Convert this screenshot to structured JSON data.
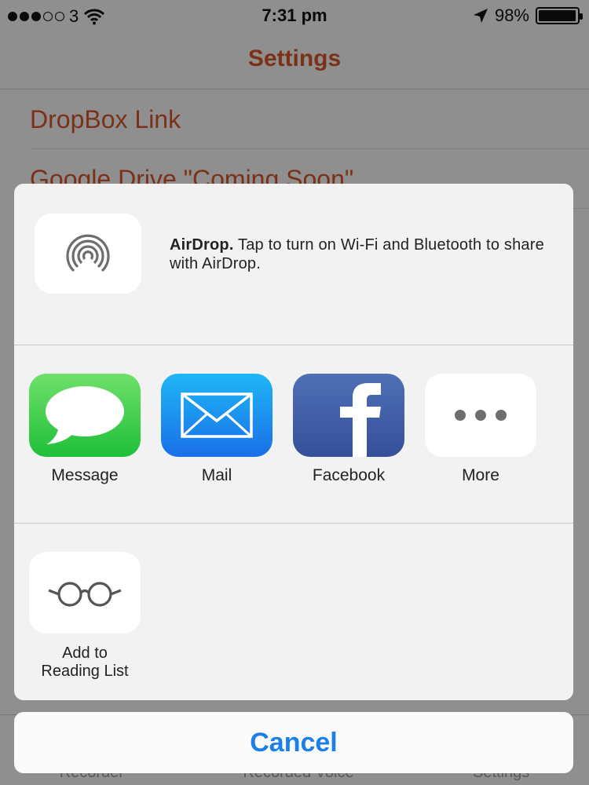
{
  "status_bar": {
    "carrier": "3",
    "time": "7:31 pm",
    "battery": "98%",
    "battery_level": 0.98
  },
  "nav": {
    "title": "Settings"
  },
  "settings": {
    "rows": [
      {
        "label": "DropBox Link"
      },
      {
        "label": "Google Drive \"Coming Soon\""
      }
    ]
  },
  "tabbar": {
    "items": [
      {
        "label": "Recorder"
      },
      {
        "label": "Recorded Voice"
      },
      {
        "label": "Settings"
      }
    ]
  },
  "share": {
    "airdrop": {
      "title": "AirDrop.",
      "message": " Tap to turn on Wi-Fi and Bluetooth to share with AirDrop."
    },
    "apps": [
      {
        "label": "Message",
        "icon": "message-icon"
      },
      {
        "label": "Mail",
        "icon": "mail-icon"
      },
      {
        "label": "Facebook",
        "icon": "facebook-icon"
      },
      {
        "label": "More",
        "icon": "more-icon"
      }
    ],
    "actions": [
      {
        "line1": "Add to",
        "line2": "Reading List",
        "icon": "reading-glasses-icon"
      }
    ],
    "cancel_label": "Cancel"
  },
  "colors": {
    "accent_orange": "#d4552a",
    "ios_blue": "#1a80e8",
    "message_green": "#1fbf3a",
    "mail_blue": "#1a6fe7",
    "facebook_blue": "#3b5998"
  }
}
